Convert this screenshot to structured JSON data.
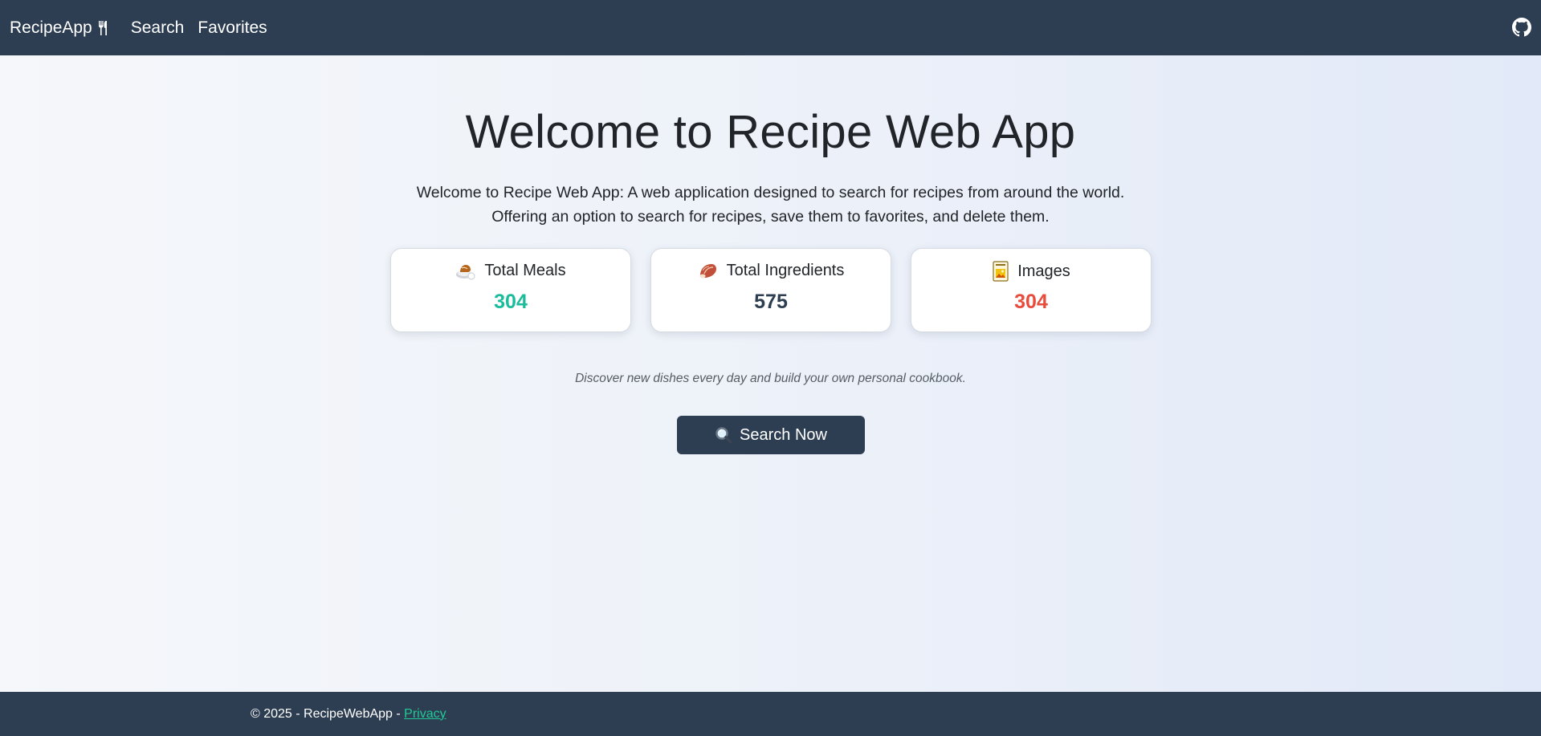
{
  "nav": {
    "brand": "RecipeApp",
    "links": [
      "Search",
      "Favorites"
    ],
    "github_icon": "github-icon"
  },
  "hero": {
    "title": "Welcome to Recipe Web App",
    "description_line1": "Welcome to Recipe Web App: A web application designed to search for recipes from around the world.",
    "description_line2": "Offering an option to search for recipes, save them to favorites, and delete them."
  },
  "stats": [
    {
      "label": "Total Meals",
      "value": "304",
      "icon": "meal-icon",
      "color": "#1abc9c"
    },
    {
      "label": "Total Ingredients",
      "value": "575",
      "icon": "ingredient-icon",
      "color": "#2c3e50"
    },
    {
      "label": "Images",
      "value": "304",
      "icon": "image-icon",
      "color": "#e74c3c"
    }
  ],
  "tagline": "Discover new dishes every day and build your own personal cookbook.",
  "cta": {
    "label": "Search Now",
    "icon": "magnifier-icon"
  },
  "footer": {
    "copyright": "© 2025 - RecipeWebApp - ",
    "privacy_label": "Privacy"
  },
  "colors": {
    "nav_bg": "#2e3e52",
    "accent": "#20c997",
    "meals": "#1abc9c",
    "ingredients": "#2c3e50",
    "images": "#e74c3c"
  }
}
